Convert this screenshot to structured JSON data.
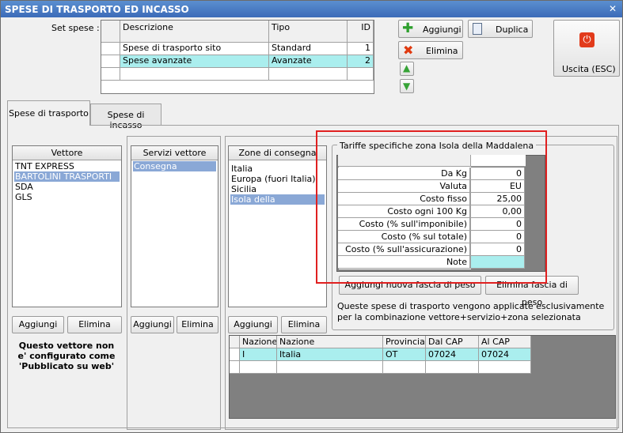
{
  "window": {
    "title": "SPESE DI TRASPORTO ED INCASSO"
  },
  "set_spese": {
    "label": "Set spese :",
    "columns": [
      "Descrizione",
      "Tipo",
      "ID"
    ],
    "rows": [
      {
        "descrizione": "Spese di trasporto sito",
        "tipo": "Standard",
        "id": "1"
      },
      {
        "descrizione": "Spese avanzate",
        "tipo": "Avanzate",
        "id": "2"
      }
    ]
  },
  "buttons": {
    "aggiungi": "Aggiungi",
    "duplica": "Duplica",
    "elimina": "Elimina",
    "uscita": "Uscita (ESC)"
  },
  "tabs": [
    "Spese di trasporto",
    "Spese di incasso"
  ],
  "vettore": {
    "header": "Vettore",
    "items": [
      "TNT EXPRESS",
      "BARTOLINI TRASPORTI",
      "SDA",
      "GLS"
    ],
    "selected": 1,
    "aggiungi": "Aggiungi",
    "elimina": "Elimina",
    "note": "Questo vettore non e' configurato come 'Pubblicato su web'"
  },
  "servizi": {
    "header": "Servizi vettore",
    "items": [
      "Consegna espressa"
    ],
    "selected": 0,
    "aggiungi": "Aggiungi",
    "elimina": "Elimina"
  },
  "zone": {
    "header": "Zone di consegna",
    "items": [
      "Italia",
      "Europa (fuori Italia)",
      "Sicilia",
      "Isola della Maddalena"
    ],
    "selected": 3,
    "aggiungi": "Aggiungi",
    "elimina": "Elimina"
  },
  "tariffe": {
    "title": "Tariffe specifiche zona Isola della Maddalena",
    "rows": [
      {
        "label": "Da Kg",
        "value": "0"
      },
      {
        "label": "Valuta",
        "value": "EU"
      },
      {
        "label": "Costo fisso",
        "value": "25,00"
      },
      {
        "label": "Costo ogni 100 Kg",
        "value": "0,00"
      },
      {
        "label": "Costo (% sull'imponibile)",
        "value": "0"
      },
      {
        "label": "Costo (% sul totale)",
        "value": "0"
      },
      {
        "label": "Costo (% sull'assicurazione)",
        "value": "0"
      },
      {
        "label": "Note",
        "value": ""
      }
    ],
    "add_band": "Aggiungi nuova fascia di peso",
    "del_band": "Elimina fascia di peso",
    "info": "Queste spese di trasporto vengono applicate esclusivamente per la combinazione vettore+servizio+zona selezionata"
  },
  "nazioni": {
    "columns": [
      "Nazione",
      "Nazione",
      "Provincia",
      "Dal CAP",
      "Al CAP"
    ],
    "rows": [
      {
        "code": "I",
        "nazione": "Italia",
        "provincia": "OT",
        "dal": "07024",
        "al": "07024"
      }
    ]
  },
  "colors": {
    "highlight_box": "#e02020",
    "selected_row": "#aaeeee",
    "list_selected": "#8aa8d6",
    "title_bar": "#4a7cc4"
  }
}
